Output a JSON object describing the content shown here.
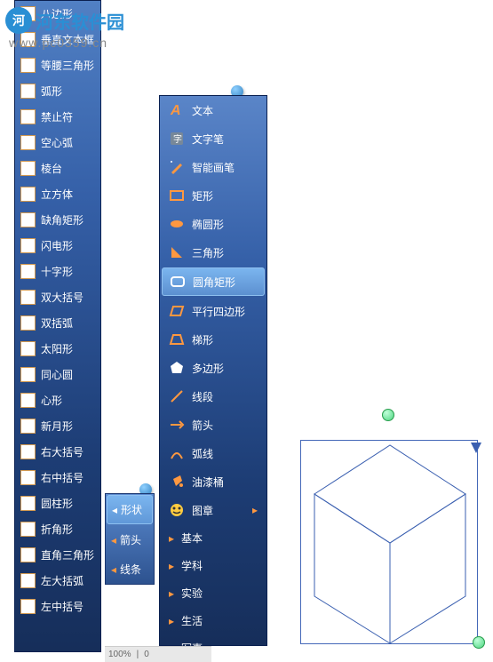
{
  "watermark": {
    "site_name": "河东软件园",
    "url": "www.pc0359.cn"
  },
  "shape_panel": {
    "items": [
      {
        "label": "八边形"
      },
      {
        "label": "垂直文本框"
      },
      {
        "label": "等腰三角形"
      },
      {
        "label": "弧形"
      },
      {
        "label": "禁止符"
      },
      {
        "label": "空心弧"
      },
      {
        "label": "棱台"
      },
      {
        "label": "立方体"
      },
      {
        "label": "缺角矩形"
      },
      {
        "label": "闪电形"
      },
      {
        "label": "十字形"
      },
      {
        "label": "双大括号"
      },
      {
        "label": "双括弧"
      },
      {
        "label": "太阳形"
      },
      {
        "label": "同心圆"
      },
      {
        "label": "心形"
      },
      {
        "label": "新月形"
      },
      {
        "label": "右大括号"
      },
      {
        "label": "右中括号"
      },
      {
        "label": "圆柱形"
      },
      {
        "label": "折角形"
      },
      {
        "label": "直角三角形"
      },
      {
        "label": "左大括弧"
      },
      {
        "label": "左中括号"
      }
    ]
  },
  "mini_panel": {
    "items": [
      {
        "label": "形状"
      },
      {
        "label": "箭头"
      },
      {
        "label": "线条"
      }
    ],
    "selected_index": 0
  },
  "main_panel": {
    "items": [
      {
        "label": "文本",
        "icon": "text"
      },
      {
        "label": "文字笔",
        "icon": "text-pen"
      },
      {
        "label": "智能画笔",
        "icon": "smart-pen"
      },
      {
        "label": "矩形",
        "icon": "rect"
      },
      {
        "label": "椭圆形",
        "icon": "ellipse"
      },
      {
        "label": "三角形",
        "icon": "triangle"
      },
      {
        "label": "圆角矩形",
        "icon": "round-rect"
      },
      {
        "label": "平行四边形",
        "icon": "parallelogram"
      },
      {
        "label": "梯形",
        "icon": "trapezoid"
      },
      {
        "label": "多边形",
        "icon": "polygon"
      },
      {
        "label": "线段",
        "icon": "line"
      },
      {
        "label": "箭头",
        "icon": "arrow"
      },
      {
        "label": "弧线",
        "icon": "arc"
      },
      {
        "label": "油漆桶",
        "icon": "bucket"
      },
      {
        "label": "图章",
        "icon": "stamp"
      },
      {
        "label": "基本",
        "icon": "none"
      },
      {
        "label": "学科",
        "icon": "none"
      },
      {
        "label": "实验",
        "icon": "none"
      },
      {
        "label": "生活",
        "icon": "none"
      },
      {
        "label": "军事",
        "icon": "none"
      }
    ],
    "selected_index": 6
  },
  "bottom_bar": {
    "zoom": "100%",
    "angle": "0"
  }
}
